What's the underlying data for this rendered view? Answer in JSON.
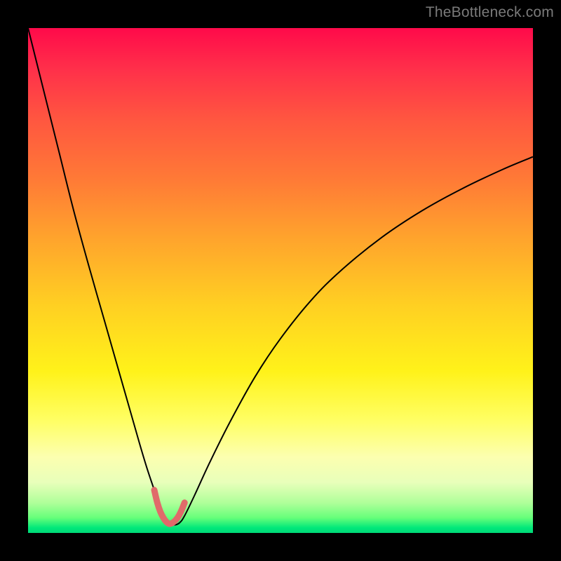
{
  "watermark": {
    "text": "TheBottleneck.com"
  },
  "chart_data": {
    "type": "line",
    "title": "",
    "xlabel": "",
    "ylabel": "",
    "xlim": [
      0,
      100
    ],
    "ylim": [
      0,
      100
    ],
    "grid": false,
    "legend": false,
    "background_gradient": {
      "orientation": "vertical",
      "stops": [
        {
          "pos": 0.0,
          "color": "#ff0a4a"
        },
        {
          "pos": 0.3,
          "color": "#ff7a36"
        },
        {
          "pos": 0.55,
          "color": "#ffd022"
        },
        {
          "pos": 0.78,
          "color": "#ffff66"
        },
        {
          "pos": 0.94,
          "color": "#b0ff9a"
        },
        {
          "pos": 1.0,
          "color": "#00d878"
        }
      ]
    },
    "series": [
      {
        "name": "bottleneck-curve",
        "stroke": "#000000",
        "stroke_width": 2,
        "x": [
          0,
          3,
          6,
          9,
          12,
          15,
          18,
          20,
          22,
          23.5,
          25,
          26,
          27,
          28,
          29,
          30,
          31,
          33,
          36,
          40,
          45,
          50,
          56,
          62,
          70,
          78,
          86,
          94,
          100
        ],
        "y": [
          100,
          88,
          76,
          64,
          53,
          42.5,
          32,
          25,
          18,
          13,
          8.5,
          5.5,
          3.2,
          2.0,
          1.6,
          2.0,
          3.4,
          7.5,
          14,
          22,
          31,
          38.5,
          46,
          52,
          58.5,
          63.8,
          68.2,
          72,
          74.5
        ]
      },
      {
        "name": "valley-highlight",
        "stroke": "#e06a6a",
        "stroke_width": 9,
        "linecap": "round",
        "x": [
          25,
          25.6,
          26.2,
          26.8,
          27.4,
          28,
          28.6,
          29.2,
          29.8,
          30.4,
          31
        ],
        "y": [
          8.5,
          6.0,
          4.2,
          3.0,
          2.2,
          1.8,
          2.0,
          2.5,
          3.3,
          4.5,
          6.0
        ]
      }
    ]
  }
}
